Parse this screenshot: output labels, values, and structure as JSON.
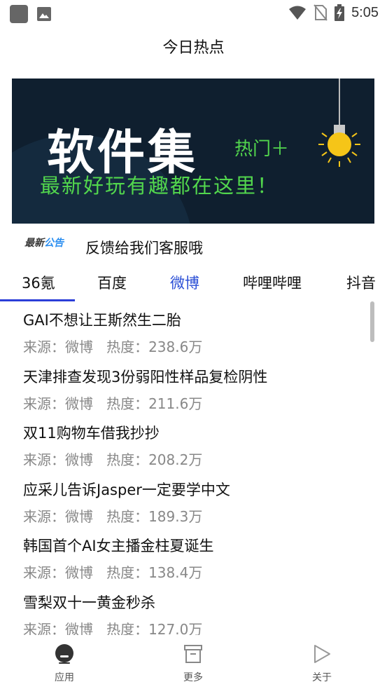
{
  "status_bar": {
    "time": "5:05",
    "icons": [
      "app-icon",
      "image-icon",
      "wifi-icon",
      "no-sim-icon",
      "battery-charging-icon"
    ]
  },
  "header": {
    "title": "今日热点"
  },
  "banner": {
    "title": "软件集",
    "hot_label": "热门＋",
    "subtitle": "最新好玩有趣都在这里！",
    "colors": {
      "background": "#0f1f2f",
      "accent": "#52d64d",
      "bulb": "#f5c518"
    }
  },
  "notice": {
    "badge_part1": "最新",
    "badge_part2": "公告",
    "text": "反馈给我们客服哦"
  },
  "tabs": [
    {
      "label": "36氪",
      "active": true
    },
    {
      "label": "百度",
      "active": false
    },
    {
      "label": "微博",
      "active": false,
      "highlighted": true
    },
    {
      "label": "哔哩哔哩",
      "active": false
    },
    {
      "label": "抖音",
      "active": false
    }
  ],
  "list": [
    {
      "title": "GAI不想让王斯然生二胎",
      "source": "来源：微博",
      "heat": "热度：238.6万"
    },
    {
      "title": "天津排查发现3份弱阳性样品复检阴性",
      "source": "来源：微博",
      "heat": "热度：211.6万"
    },
    {
      "title": "双11购物车借我抄抄",
      "source": "来源：微博",
      "heat": "热度：208.2万"
    },
    {
      "title": "应采儿告诉Jasper一定要学中文",
      "source": "来源：微博",
      "heat": "热度：189.3万"
    },
    {
      "title": "韩国首个AI女主播金柱夏诞生",
      "source": "来源：微博",
      "heat": "热度：138.4万"
    },
    {
      "title": "雪梨双十一黄金秒杀",
      "source": "来源：微博",
      "heat": "热度：127.0万"
    }
  ],
  "bottom_nav": [
    {
      "label": "应用",
      "icon": "apps-icon",
      "active": true
    },
    {
      "label": "更多",
      "icon": "box-icon",
      "active": false
    },
    {
      "label": "关于",
      "icon": "play-icon",
      "active": false
    }
  ],
  "colors": {
    "tab_accent": "#2b3ed8",
    "meta_text": "#888888"
  }
}
